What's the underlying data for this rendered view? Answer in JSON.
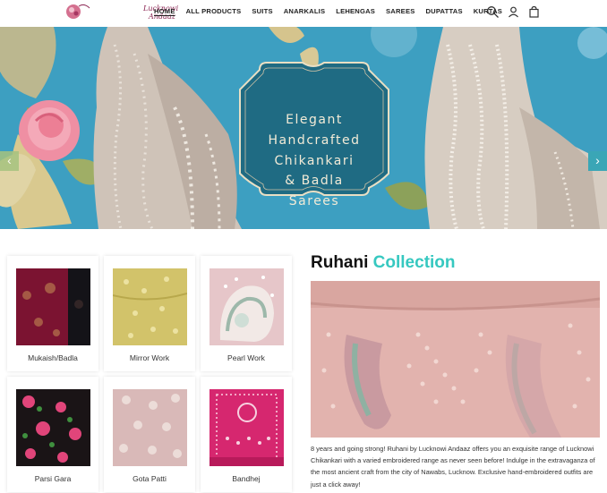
{
  "brand": {
    "logo_text_line1": "Lucknowi",
    "logo_text_line2": "Andaaz"
  },
  "nav": {
    "items": [
      {
        "label": "HOME",
        "active": true
      },
      {
        "label": "ALL PRODUCTS"
      },
      {
        "label": "SUITS"
      },
      {
        "label": "ANARKALIS"
      },
      {
        "label": "LEHENGAS"
      },
      {
        "label": "SAREES"
      },
      {
        "label": "DUPATTAS"
      },
      {
        "label": "KURTAS"
      }
    ]
  },
  "header_icons": [
    "search-icon",
    "account-icon",
    "cart-icon"
  ],
  "banner": {
    "lines": [
      "Elegant",
      "Handcrafted",
      "Chikankari",
      "& Badla",
      "Sarees"
    ],
    "prev_label": "‹",
    "next_label": "›"
  },
  "tiles": [
    {
      "label": "Mukaish/Badla"
    },
    {
      "label": "Mirror Work"
    },
    {
      "label": "Pearl Work"
    },
    {
      "label": "Parsi Gara"
    },
    {
      "label": "Gota Patti"
    },
    {
      "label": "Bandhej"
    }
  ],
  "collection": {
    "title_part1": "Ruhani",
    "title_part2": "Collection",
    "description": "8 years and going strong! Ruhani by Lucknowi Andaaz offers you an exquisite range of Lucknowi Chikankari with a varied embroidered range as never seen before! Indulge in the extravaganza of the most ancient craft from the city of Nawabs, Lucknow. Exclusive hand-embroidered outfits are just a click away!"
  },
  "colors": {
    "accent": "#36c8c0",
    "banner_bg": "#3d9fc1",
    "plaque": "#1e6a82",
    "brand": "#8a2452"
  }
}
